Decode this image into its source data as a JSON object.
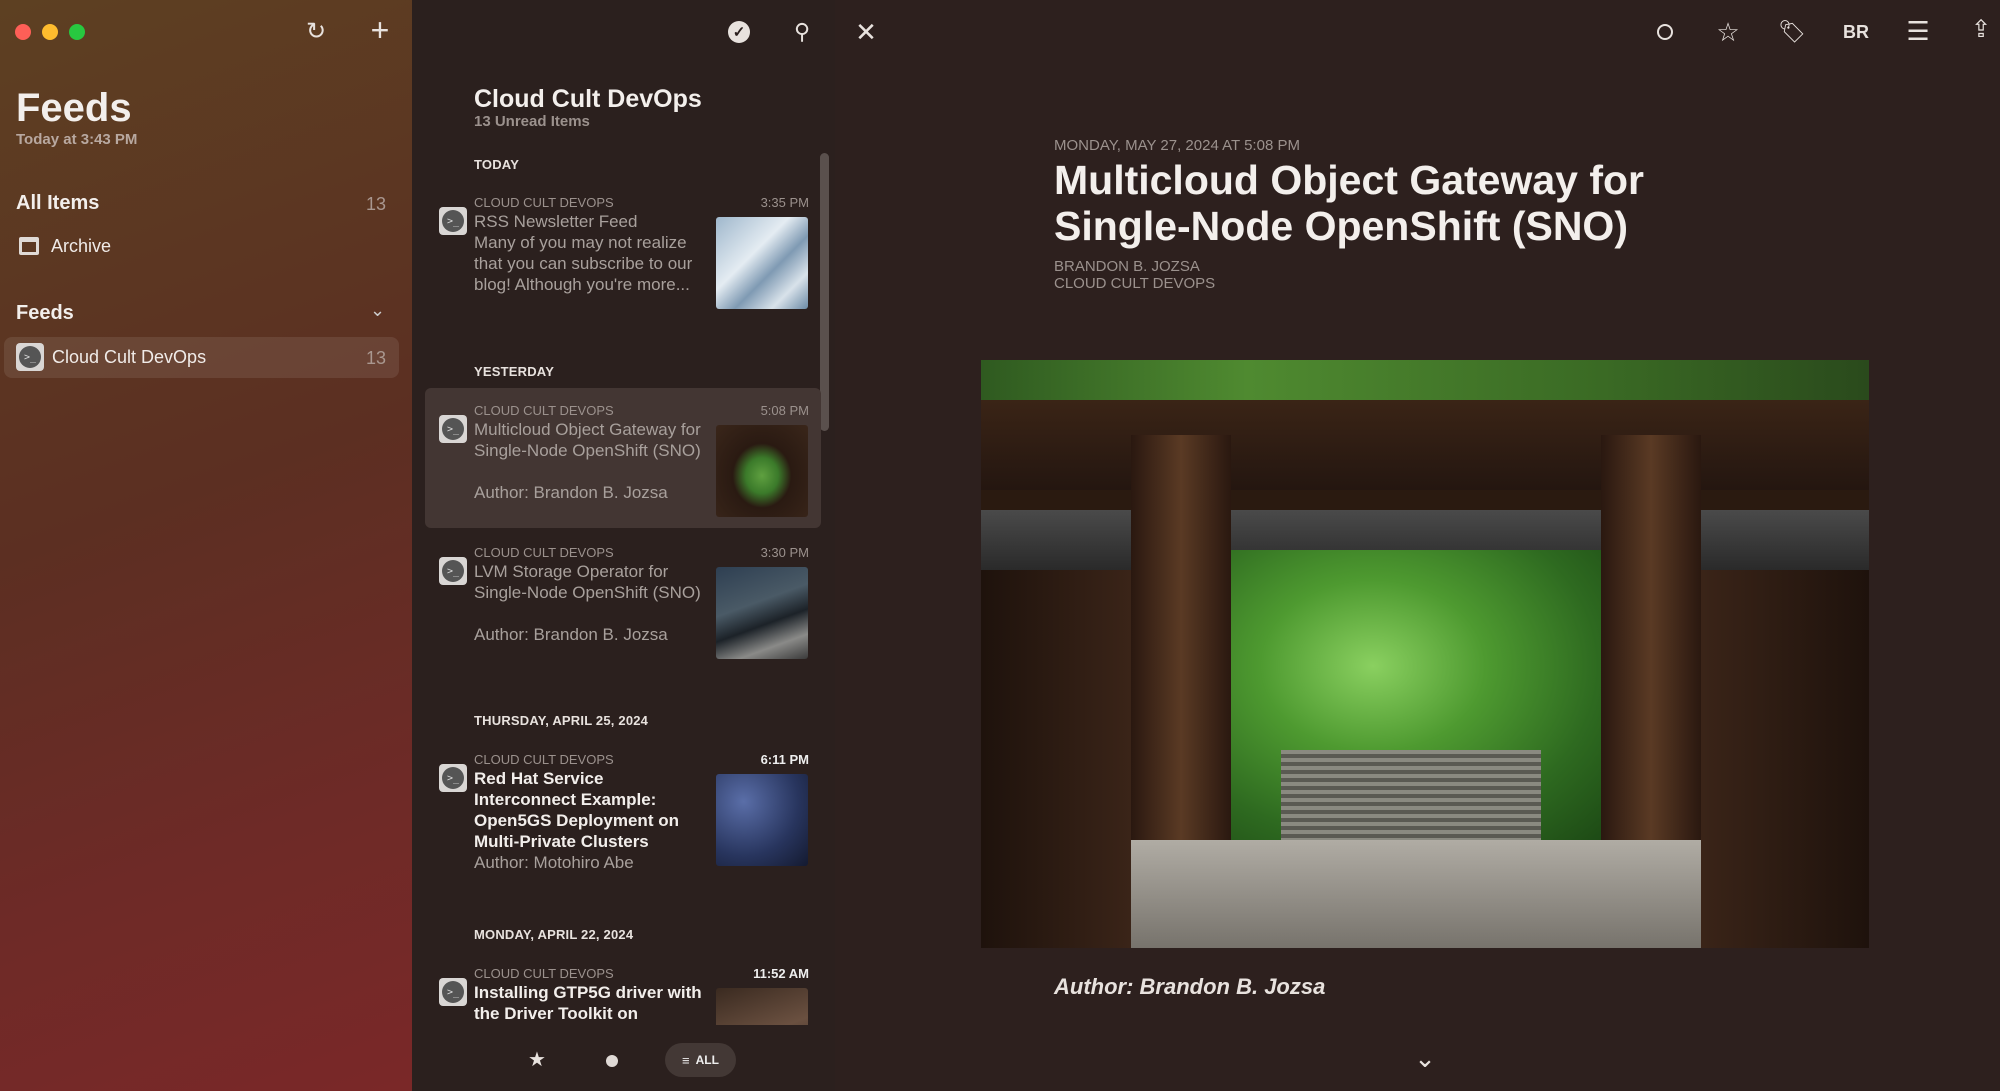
{
  "sidebar": {
    "title": "Feeds",
    "updated": "Today at 3:43 PM",
    "all_items": {
      "label": "All Items",
      "count": "13"
    },
    "archive": {
      "label": "Archive"
    },
    "feeds_header": "Feeds",
    "feeds": [
      {
        "label": "Cloud Cult DevOps",
        "count": "13"
      }
    ]
  },
  "list": {
    "title": "Cloud Cult DevOps",
    "subtitle": "13 Unread Items",
    "sections": [
      "TODAY",
      "YESTERDAY",
      "THURSDAY, APRIL 25, 2024",
      "MONDAY, APRIL 22, 2024"
    ],
    "items": [
      {
        "feed": "CLOUD CULT DEVOPS",
        "time": "3:35 PM",
        "title": "RSS Newsletter Feed",
        "preview": "Many of you may not realize that you can subscribe to our blog! Although you're more...",
        "read": true
      },
      {
        "feed": "CLOUD CULT DEVOPS",
        "time": "5:08 PM",
        "title": "Multicloud Object Gateway for Single-Node OpenShift (SNO)",
        "preview": "Author: Brandon B. Jozsa",
        "read": true,
        "selected": true
      },
      {
        "feed": "CLOUD CULT DEVOPS",
        "time": "3:30 PM",
        "title": "LVM Storage Operator for Single-Node OpenShift (SNO)",
        "preview": "Author: Brandon B. Jozsa",
        "read": true
      },
      {
        "feed": "CLOUD CULT DEVOPS",
        "time": "6:11 PM",
        "title": "Red Hat Service Interconnect Example: Open5GS Deployment on Multi-Private Clusters",
        "preview": "Author: Motohiro Abe",
        "read": false
      },
      {
        "feed": "CLOUD CULT DEVOPS",
        "time": "11:52 AM",
        "title": "Installing GTP5G driver with the Driver Toolkit on",
        "preview": "",
        "read": false
      }
    ],
    "filter_all": "ALL"
  },
  "article": {
    "date": "MONDAY, MAY 27, 2024 AT 5:08 PM",
    "title": "Multicloud Object Gateway for Single-Node OpenShift (SNO)",
    "author": "BRANDON B. JOZSA",
    "feed": "CLOUD CULT DEVOPS",
    "byline": "Author: Brandon B. Jozsa",
    "reader_label": "BR"
  },
  "colors": {
    "sidebar": "#5d4022",
    "list_bg": "#2b201e",
    "content_bg": "#2d201e",
    "selected": "#433633"
  }
}
